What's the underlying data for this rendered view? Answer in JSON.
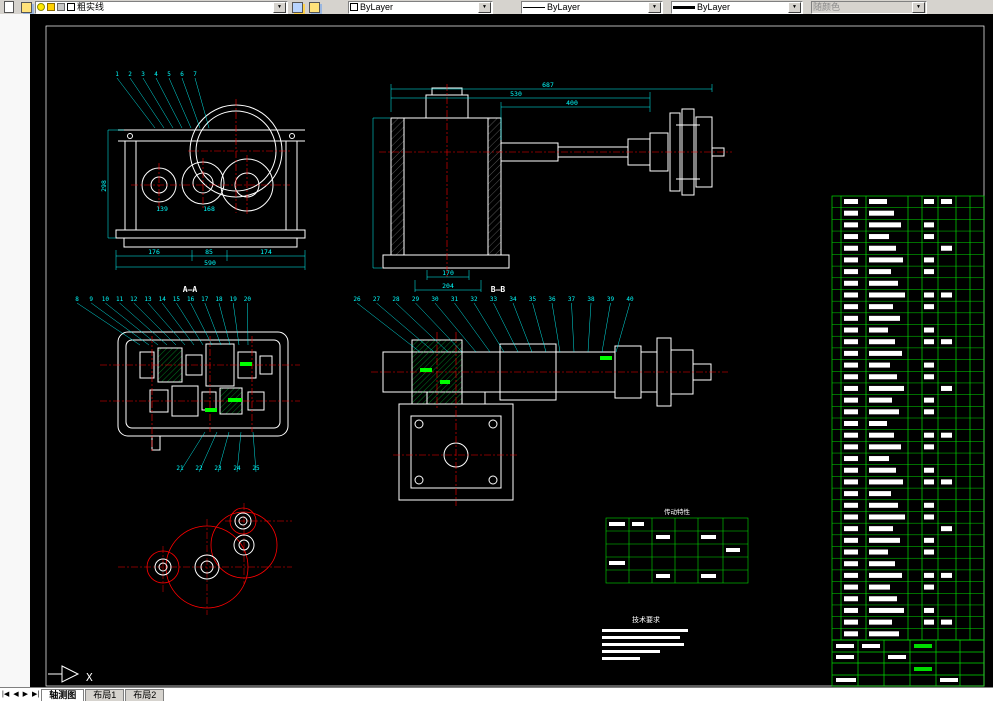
{
  "toolbar": {
    "layer": {
      "value": "粗实线"
    },
    "color": {
      "value": "ByLayer"
    },
    "linetype": {
      "value": "ByLayer"
    },
    "lineweight": {
      "value": "ByLayer"
    },
    "plot_style": {
      "value": "随颜色"
    }
  },
  "tabbar": {
    "nav": [
      "|◀",
      "◀",
      "▶",
      "▶|"
    ],
    "tabs": [
      "轴测图",
      "布局1",
      "布局2"
    ]
  },
  "drawing": {
    "section_labels": {
      "aa": "A—A",
      "bb": "B—B"
    },
    "tech_requirements_title": "技术要求",
    "spec_table_title": "传动特性",
    "ucs_label": "X",
    "dims": {
      "side_total": "687",
      "side_upper": "530",
      "side_inner": "400",
      "side_base_inner": "170",
      "side_base_outer": "204",
      "front_seg1": "176",
      "front_seg2": "85",
      "front_seg3": "174",
      "front_total": "590",
      "front_height": "298",
      "front_c1": "139",
      "front_c2": "168"
    },
    "callouts": {
      "front": [
        "1",
        "2",
        "3",
        "4",
        "5",
        "6",
        "7"
      ],
      "aa_top": [
        "8",
        "9",
        "10",
        "11",
        "12",
        "13",
        "14",
        "15",
        "16",
        "17",
        "18",
        "19",
        "20"
      ],
      "aa_bottom": [
        "21",
        "22",
        "23",
        "24",
        "25"
      ],
      "bb_top": [
        "26",
        "27",
        "28",
        "29",
        "30",
        "31",
        "32",
        "33",
        "34",
        "35",
        "36",
        "37",
        "38",
        "39",
        "40"
      ]
    },
    "bom": {
      "row_count": 38
    }
  },
  "colors": {
    "canvas_bg": "#000000",
    "geometry": "#ffffff",
    "dimension": "#00ffff",
    "table": "#00dd00",
    "centerline": "#ff0000",
    "highlight": "#00ff00"
  }
}
